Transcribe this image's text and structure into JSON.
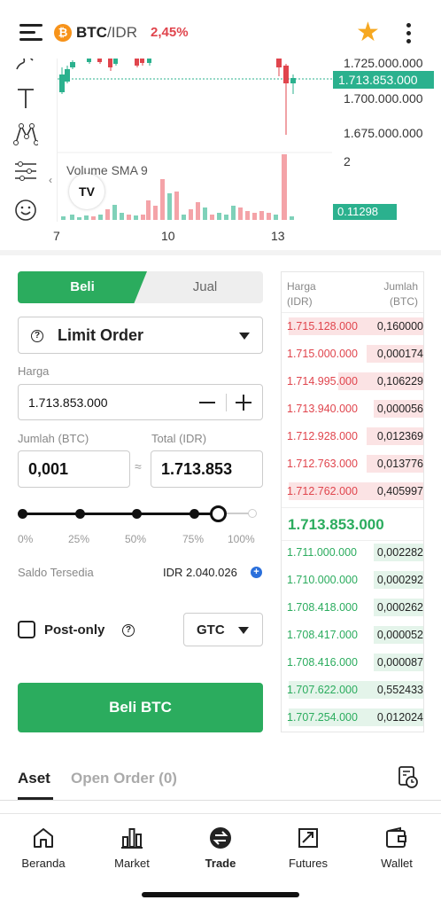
{
  "header": {
    "coin_symbol": "₿",
    "base": "BTC",
    "separator": "/",
    "quote": "IDR",
    "change": "2,45%",
    "icons": [
      "menu-icon",
      "star-icon",
      "more-vertical-icon"
    ],
    "colors": {
      "up": "#2bac5e",
      "down": "#e0454d",
      "star": "#f6a821"
    }
  },
  "chart": {
    "price_labels": [
      "1.725.000.000",
      "1.700.000.000",
      "1.675.000.000"
    ],
    "current_price": "1.713.853.000",
    "volume_title": "Volume SMA 9",
    "volume_axis_label": "2",
    "volume_current": "0.11298",
    "x_labels": [
      "7",
      "10",
      "13"
    ],
    "logo_text": "TV",
    "tools": [
      "brush-icon",
      "text-icon",
      "pattern-icon",
      "indicator-settings-icon",
      "emoji-icon"
    ]
  },
  "form": {
    "tab_buy": "Beli",
    "tab_sell": "Jual",
    "order_type": "Limit Order",
    "price_label": "Harga",
    "price_value": "1.713.853.000",
    "amount_label": "Jumlah (BTC)",
    "total_label": "Total (IDR)",
    "amount_value": "0,001",
    "approx_symbol": "≈",
    "total_value": "1.713.853",
    "percent_labels": [
      "0%",
      "25%",
      "50%",
      "75%",
      "100%"
    ],
    "slider_value": 0.85,
    "saldo_label": "Saldo Tersedia",
    "saldo_value": "IDR 2.040.026",
    "post_only": "Post-only",
    "tif": "GTC",
    "buy_button": "Beli BTC"
  },
  "orderbook": {
    "header_price": "Harga",
    "header_price_unit": "(IDR)",
    "header_amount": "Jumlah",
    "header_amount_unit": "(BTC)",
    "asks": [
      {
        "price": "1.715.128.000",
        "amount": "0,160000",
        "depth": 0.95
      },
      {
        "price": "1.715.000.000",
        "amount": "0,000174",
        "depth": 0.4
      },
      {
        "price": "1.714.995.000",
        "amount": "0,106229",
        "depth": 0.6
      },
      {
        "price": "1.713.940.000",
        "amount": "0,000056",
        "depth": 0.35
      },
      {
        "price": "1.712.928.000",
        "amount": "0,012369",
        "depth": 0.4
      },
      {
        "price": "1.712.763.000",
        "amount": "0,013776",
        "depth": 0.4
      },
      {
        "price": "1.712.762.000",
        "amount": "0,405997",
        "depth": 0.95
      }
    ],
    "mid_price": "1.713.853.000",
    "bids": [
      {
        "price": "1.711.000.000",
        "amount": "0,002282",
        "depth": 0.35
      },
      {
        "price": "1.710.000.000",
        "amount": "0,000292",
        "depth": 0.35
      },
      {
        "price": "1.708.418.000",
        "amount": "0,000262",
        "depth": 0.35
      },
      {
        "price": "1.708.417.000",
        "amount": "0,000052",
        "depth": 0.35
      },
      {
        "price": "1.708.416.000",
        "amount": "0,000087",
        "depth": 0.35
      },
      {
        "price": "1.707.622.000",
        "amount": "0,552433",
        "depth": 0.95
      },
      {
        "price": "1.707.254.000",
        "amount": "0,012024",
        "depth": 0.95
      }
    ]
  },
  "bottom_tabs": {
    "assets": "Aset",
    "open_orders": "Open Order (0)"
  },
  "nav": [
    {
      "label": "Beranda",
      "icon": "home-icon"
    },
    {
      "label": "Market",
      "icon": "market-icon"
    },
    {
      "label": "Trade",
      "icon": "trade-icon"
    },
    {
      "label": "Futures",
      "icon": "futures-icon"
    },
    {
      "label": "Wallet",
      "icon": "wallet-icon"
    }
  ]
}
